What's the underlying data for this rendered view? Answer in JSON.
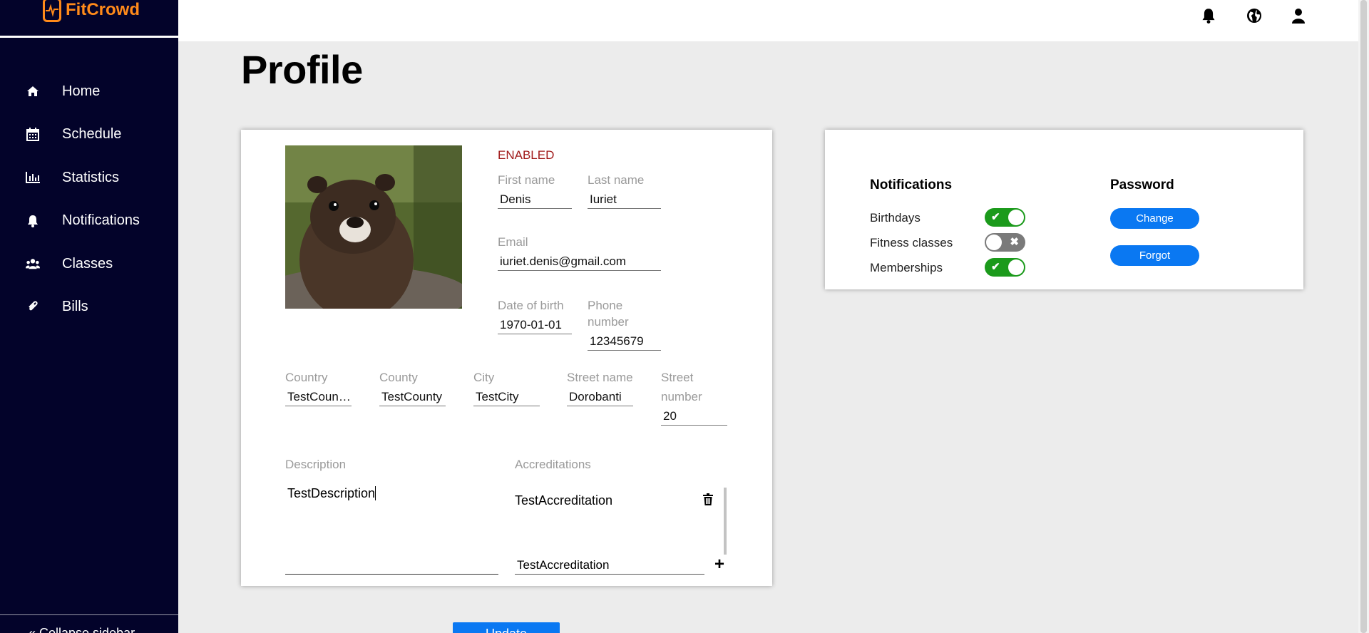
{
  "app": {
    "name": "FitCrowd"
  },
  "sidebar": {
    "items": [
      {
        "label": "Home",
        "icon": "home-icon"
      },
      {
        "label": "Schedule",
        "icon": "calendar-icon"
      },
      {
        "label": "Statistics",
        "icon": "bar-chart-icon"
      },
      {
        "label": "Notifications",
        "icon": "bell-icon"
      },
      {
        "label": "Classes",
        "icon": "users-icon"
      },
      {
        "label": "Bills",
        "icon": "paperclip-icon"
      }
    ],
    "collapse_label": "« Collapse sidebar"
  },
  "topbar": {
    "icons": [
      "bell-icon",
      "globe-icon",
      "user-icon"
    ]
  },
  "page": {
    "title": "Profile"
  },
  "profile": {
    "status": "ENABLED",
    "first_name": {
      "label": "First name",
      "value": "Denis"
    },
    "last_name": {
      "label": "Last name",
      "value": "Iuriet"
    },
    "email": {
      "label": "Email",
      "value": "iuriet.denis@gmail.com"
    },
    "dob": {
      "label": "Date of birth",
      "value": "1970-01-01"
    },
    "phone": {
      "label_line1": "Phone",
      "label_line2": "number",
      "value": "12345679"
    },
    "country": {
      "label": "Country",
      "value": "TestCountry"
    },
    "county": {
      "label": "County",
      "value": "TestCounty"
    },
    "city": {
      "label": "City",
      "value": "TestCity"
    },
    "street_name": {
      "label": "Street name",
      "value": "Dorobanti"
    },
    "street_number": {
      "label_line1": "Street",
      "label_line2": "number",
      "value": "20"
    },
    "description": {
      "label": "Description",
      "value": "TestDescription"
    },
    "accreditations": {
      "label": "Accreditations",
      "items": [
        "TestAccreditation"
      ],
      "new_value": "TestAccreditation"
    },
    "update_label": "Update"
  },
  "settings": {
    "notifications_title": "Notifications",
    "password_title": "Password",
    "notifications": [
      {
        "label": "Birthdays",
        "enabled": true
      },
      {
        "label": "Fitness classes",
        "enabled": false
      },
      {
        "label": "Memberships",
        "enabled": true
      }
    ],
    "change_label": "Change",
    "forgot_label": "Forgot"
  },
  "colors": {
    "sidebar_bg": "#03032a",
    "brand_orange": "#ff8a1a",
    "primary_blue": "#0a78f2",
    "toggle_on": "#1b9a1b",
    "toggle_off": "#7a7a7a",
    "status_red": "#a11b1b"
  }
}
